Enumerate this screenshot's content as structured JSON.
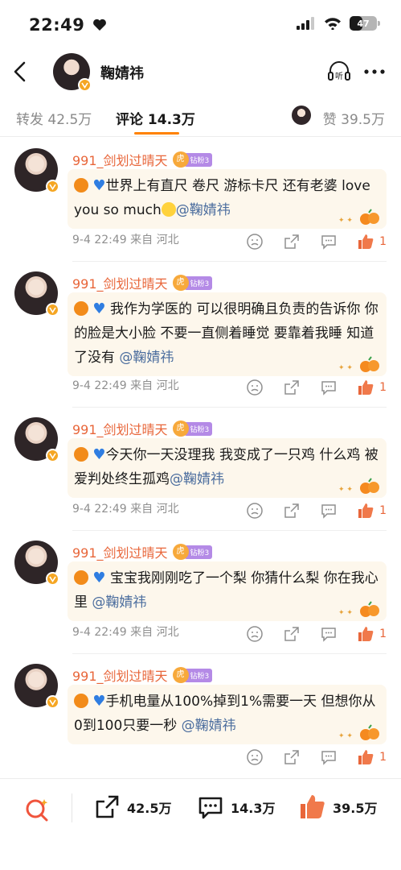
{
  "status_bar": {
    "time": "22:49",
    "battery": "47"
  },
  "header": {
    "name": "鞠婧祎",
    "listen_label": "听"
  },
  "tabs": {
    "repost": "转发 42.5万",
    "comment": "评论 14.3万",
    "like": "赞 39.5万"
  },
  "comments": [
    {
      "user": "991_剑划过晴天",
      "badge": "钻粉3",
      "text": "世界上有直尺 卷尺 游标卡尺 还有老婆 love you so much",
      "emoji_after": true,
      "mention": "@鞠婧祎",
      "time": "9-4 22:49",
      "location": "来自 河北",
      "likes": "1"
    },
    {
      "user": "991_剑划过晴天",
      "badge": "钻粉3",
      "text": " 我作为学医的 可以很明确且负责的告诉你 你的脸是大小脸 不要一直侧着睡觉 要靠着我睡 知道了没有 ",
      "emoji_after": false,
      "mention": "@鞠婧祎",
      "time": "9-4 22:49",
      "location": "来自 河北",
      "likes": "1"
    },
    {
      "user": "991_剑划过晴天",
      "badge": "钻粉3",
      "text": "今天你一天没理我 我变成了一只鸡 什么鸡 被爱判处终生孤鸡",
      "emoji_after": false,
      "mention": "@鞠婧祎",
      "time": "9-4 22:49",
      "location": "来自 河北",
      "likes": "1"
    },
    {
      "user": "991_剑划过晴天",
      "badge": "钻粉3",
      "text": " 宝宝我刚刚吃了一个梨 你猜什么梨 你在我心里 ",
      "emoji_after": false,
      "mention": "@鞠婧祎",
      "time": "9-4 22:49",
      "location": "来自 河北",
      "likes": "1"
    },
    {
      "user": "991_剑划过晴天",
      "badge": "钻粉3",
      "text": "手机电量从100%掉到1%需要一天 但想你从0到100只要一秒",
      "emoji_after": false,
      "mention": "@鞠婧祎",
      "time": "",
      "location": "",
      "likes": "1"
    }
  ],
  "bottom_bar": {
    "reposts": "42.5万",
    "comments": "14.3万",
    "likes": "39.5万"
  },
  "colors": {
    "accent": "#ff8200",
    "username": "#e8663a",
    "mention": "#4b6d9e",
    "bubble": "#fdf7ec"
  }
}
